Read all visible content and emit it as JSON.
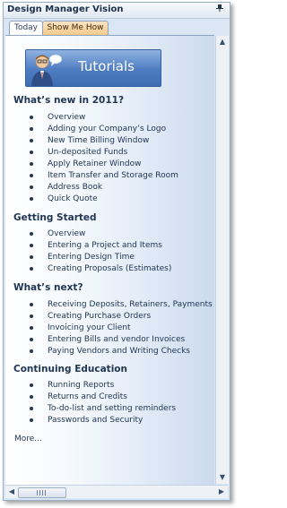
{
  "window": {
    "title": "Design Manager Vision"
  },
  "tabs": [
    {
      "label": "Today"
    },
    {
      "label": "Show Me How"
    }
  ],
  "banner": {
    "label": "Tutorials"
  },
  "sections": [
    {
      "heading": "What’s new in 2011?",
      "items": [
        "Overview",
        "Adding your Company’s Logo",
        "New Time Billing Window",
        "Un-deposited Funds",
        "Apply Retainer Window",
        "Item Transfer and Storage Room",
        "Address Book",
        "Quick Quote"
      ]
    },
    {
      "heading": "Getting Started",
      "items": [
        "Overview",
        "Entering a Project and Items",
        "Entering Design Time",
        "Creating Proposals (Estimates)"
      ]
    },
    {
      "heading": "What’s next?",
      "items": [
        "Receiving Deposits, Retainers, Payments",
        "Creating Purchase Orders",
        "Invoicing your Client",
        "Entering Bills and vendor Invoices",
        "Paying Vendors and Writing Checks"
      ]
    },
    {
      "heading": "Continuing Education",
      "items": [
        "Running Reports",
        "Returns and Credits",
        "To-do-list and setting reminders",
        "Passwords and Security"
      ]
    }
  ],
  "more": {
    "label": "More..."
  }
}
